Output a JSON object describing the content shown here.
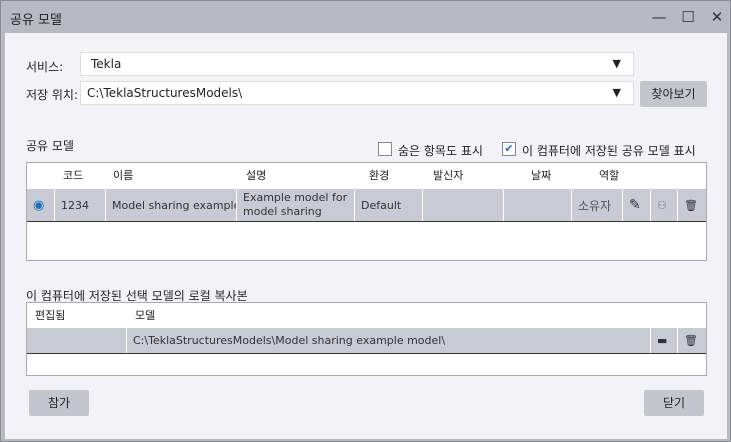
{
  "window": {
    "title": "공유 모델",
    "minimize": "—",
    "maximize": "☐",
    "close": "✕"
  },
  "service": {
    "label": "서비스:",
    "value": "Tekla"
  },
  "location": {
    "label": "저장 위치:",
    "value": "C:\\TeklaStructuresModels\\",
    "browse": "찾아보기"
  },
  "shared": {
    "label": "공유 모델",
    "show_hidden": "숨은 항목도 표시",
    "show_hidden_checked": false,
    "show_local": "이 컴퓨터에 저장된 공유 모델 표시",
    "show_local_checked": true,
    "columns": [
      "코드",
      "이름",
      "설명",
      "환경",
      "발신자",
      "날짜",
      "역할"
    ],
    "rows": [
      {
        "code": "1234",
        "name": "Model sharing example",
        "desc": "Example model for model sharing",
        "env": "Default",
        "sender": "",
        "date": "",
        "role": "소유자"
      }
    ]
  },
  "local": {
    "label": "이 컴퓨터에 저장된 선택 모델의 로컬 복사본",
    "columns": [
      "편집됨",
      "모델"
    ],
    "rows": [
      {
        "edited": "",
        "model": "C:\\TeklaStructuresModels\\Model sharing example model\\"
      }
    ]
  },
  "footer": {
    "join": "참가",
    "close": "닫기"
  },
  "colors": {
    "accent": "#1a6fb5",
    "row": "#c9cbd4"
  }
}
